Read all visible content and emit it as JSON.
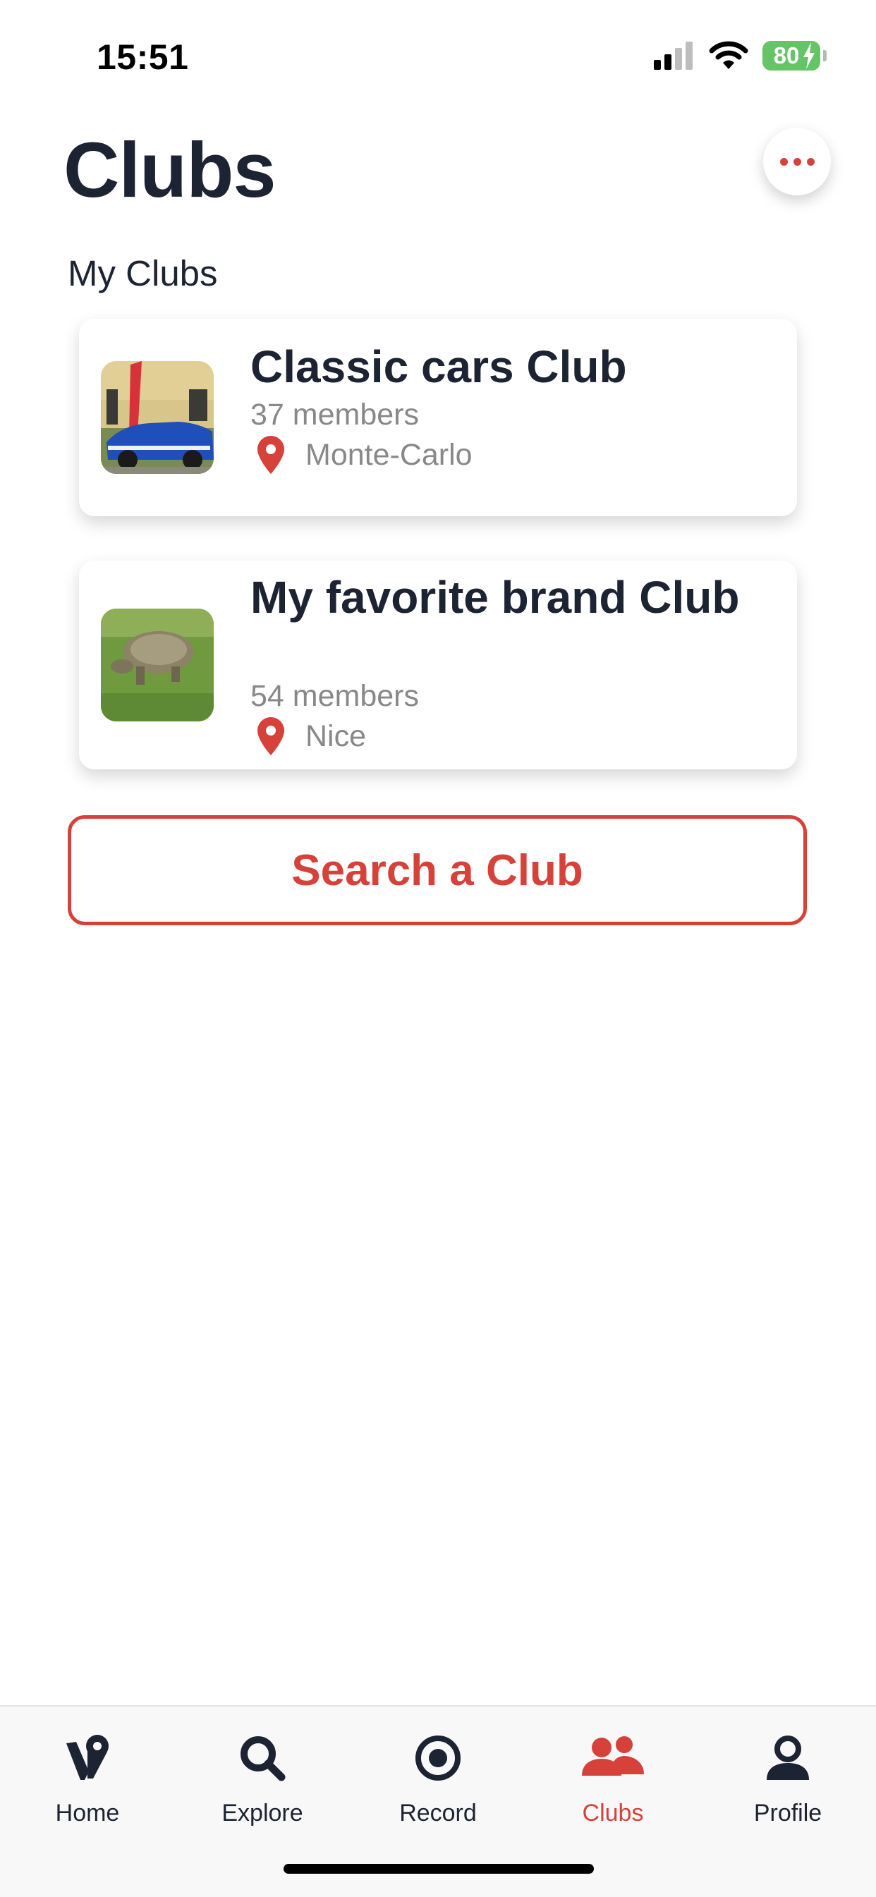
{
  "status_bar": {
    "time": "15:51",
    "battery": "80"
  },
  "header": {
    "title": "Clubs",
    "more_icon": "ellipsis-icon"
  },
  "section_label": "My Clubs",
  "clubs": [
    {
      "name": "Classic cars Club",
      "members": "37 members",
      "location": "Monte-Carlo",
      "image": "classic-car-photo"
    },
    {
      "name": "My favorite brand Club",
      "members": "54 members",
      "location": "Nice",
      "image": "tortoise-photo"
    }
  ],
  "search_button": "Search a Club",
  "tabs": [
    {
      "label": "Home",
      "icon": "home-logo-icon",
      "active": false
    },
    {
      "label": "Explore",
      "icon": "search-icon",
      "active": false
    },
    {
      "label": "Record",
      "icon": "record-icon",
      "active": false
    },
    {
      "label": "Clubs",
      "icon": "people-icon",
      "active": true
    },
    {
      "label": "Profile",
      "icon": "person-icon",
      "active": false
    }
  ],
  "colors": {
    "accent": "#d6423a",
    "text": "#1c2333",
    "muted": "#888888",
    "battery": "#65c466"
  }
}
